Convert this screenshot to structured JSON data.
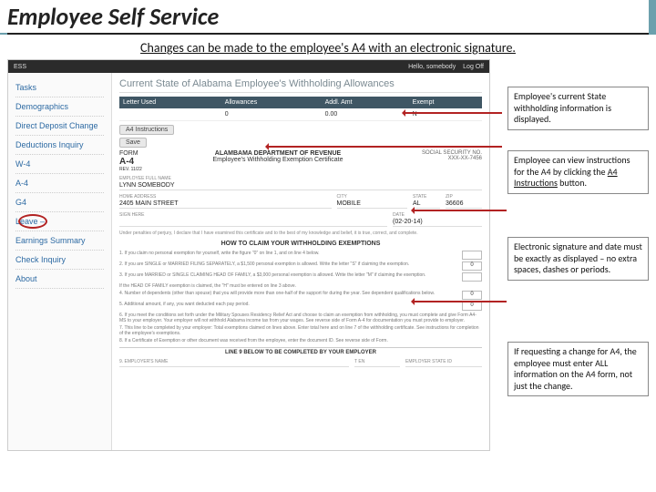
{
  "slide": {
    "title": "Employee Self Service",
    "subtitle": "Changes can be made to the employee's A4 with an electronic signature."
  },
  "ess": {
    "brand": "ESS",
    "hello": "Hello, somebody",
    "logoff": "Log Off",
    "nav": [
      "Tasks",
      "Demographics",
      "Direct Deposit Change",
      "Deductions Inquiry",
      "W-4",
      "A-4",
      "G4",
      "Leave –",
      "Earnings Summary",
      "Check Inquiry",
      "About"
    ],
    "heading": "Current State of Alabama Employee's Withholding Allowances",
    "table": {
      "headers": [
        "Letter Used",
        "Allowances",
        "Addl. Amt",
        "Exempt"
      ],
      "row": [
        "",
        "0",
        "0.00",
        "N"
      ]
    },
    "buttons": {
      "instructions": "A4 Instructions",
      "save": "Save"
    },
    "form": {
      "label": "FORM",
      "code": "A-4",
      "rev": "REV. 11/22",
      "dept": "ALAMBAMA DEPARTMENT OF REVENUE",
      "title": "Employee's Withholding Exemption Certificate",
      "ssnlab": "SOCIAL SECURITY NO.",
      "ssn": "XXX-XX-7456",
      "name": {
        "lab": "EMPLOYEE FULL NAME",
        "val": "LYNN SOMEBODY"
      },
      "rows": [
        {
          "labs": [
            "HOME ADDRESS",
            "CITY",
            "STATE",
            "ZIP"
          ],
          "vals": [
            "2405 MAIN STREET",
            "MOBILE",
            "AL",
            "36606"
          ]
        },
        {
          "labs": [
            "SIGN HERE",
            "DATE"
          ],
          "vals": [
            "",
            "(02-20-14)"
          ]
        }
      ],
      "penalty": "Under penalties of perjury, I declare that I have examined this certificate and to the best of my knowledge and belief, it is true, correct, and complete.",
      "howto": "HOW TO CLAIM YOUR WITHHOLDING EXEMPTIONS",
      "lines": [
        {
          "t": "1. If you claim no personal exemption for yourself, write the figure \"0\" on line 1, and on line 4 below.",
          "v": ""
        },
        {
          "t": "2. If you are SINGLE or MARRIED FILING SEPARATELY, a $1,500 personal exemption is allowed. Write the letter \"S\" if claiming the exemption.",
          "v": "0"
        },
        {
          "t": "3. If you are MARRIED or SINGLE CLAIMING HEAD OF FAMILY, a $3,000 personal exemption is allowed. Write the letter \"M\" if claiming the exemption.",
          "v": ""
        },
        {
          "t": "If the HEAD OF FAMILY exemption is claimed, the \"H\" must be entered on line 3 above.",
          "v": ""
        },
        {
          "t": "4. Number of dependents (other than spouse) that you will provide more than one-half of the support for during the year. See dependent qualifications below.",
          "v": "0"
        },
        {
          "t": "5. Additional amount, if any, you want deducted each pay period.",
          "v": "0"
        },
        {
          "t": "6. If you meet the conditions set forth under the Military Spouses Residency Relief Act and choose to claim an exemption from withholding, you must complete and give Form A4-MS to your employer. Your employer will not withhold Alabama income tax from your wages. See reverse side of Form A-4 for documentation you must provide to employer.",
          "v": ""
        },
        {
          "t": "7. This line to be completed by your employer: Total exemptions claimed on lines above. Enter total here and on line 7 of the withholding certificate. See instructions for completion of the employee's exemptions.",
          "v": ""
        },
        {
          "t": "8. If a Certificate of Exemption or other document was received from the employee, enter the document ID. See reverse side of Form.",
          "v": ""
        }
      ],
      "below": "LINE 9 BELOW TO BE COMPLETED BY YOUR EMPLOYER",
      "emp": {
        "labs": [
          "9. EMPLOYER'S NAME",
          "",
          "T EN",
          "EMPLOYER STATE ID"
        ]
      }
    }
  },
  "callouts": {
    "c1": "Employee's current State withholding information is displayed.",
    "c2a": "Employee can view instructions for the A4 by clicking the ",
    "c2b": "A4 Instructions",
    "c2c": " button.",
    "c3": "Electronic signature and date must be exactly as displayed – no extra spaces, dashes or periods.",
    "c4": "If requesting a change for A4, the employee must enter ALL information on the A4 form, not just the change."
  }
}
